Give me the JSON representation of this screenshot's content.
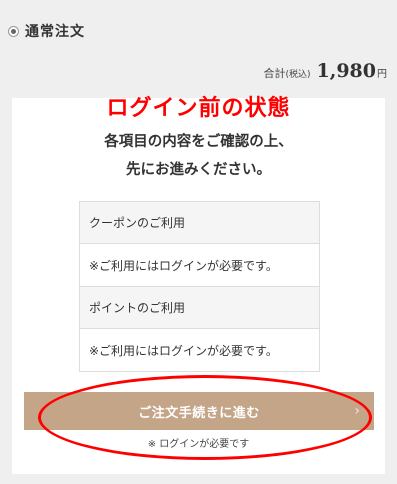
{
  "order_option": {
    "label": "通常注文"
  },
  "total": {
    "label": "合計",
    "tax": "(税込)",
    "amount": "1,980",
    "currency": "円"
  },
  "annotation": {
    "title": "ログイン前の状態"
  },
  "instruction": {
    "line1": "各項目の内容をご確認の上、",
    "line2": "先にお進みください。"
  },
  "coupon": {
    "header": "クーポンのご利用",
    "note": "※ご利用にはログインが必要です。"
  },
  "points": {
    "header": "ポイントのご利用",
    "note": "※ご利用にはログインが必要です。"
  },
  "checkout": {
    "button_label": "ご注文手続きに進む",
    "chevron": "›",
    "note": "※ ログインが必要です"
  },
  "colors": {
    "accent_button": "#c4a588",
    "annotation_red": "#ff0000"
  }
}
